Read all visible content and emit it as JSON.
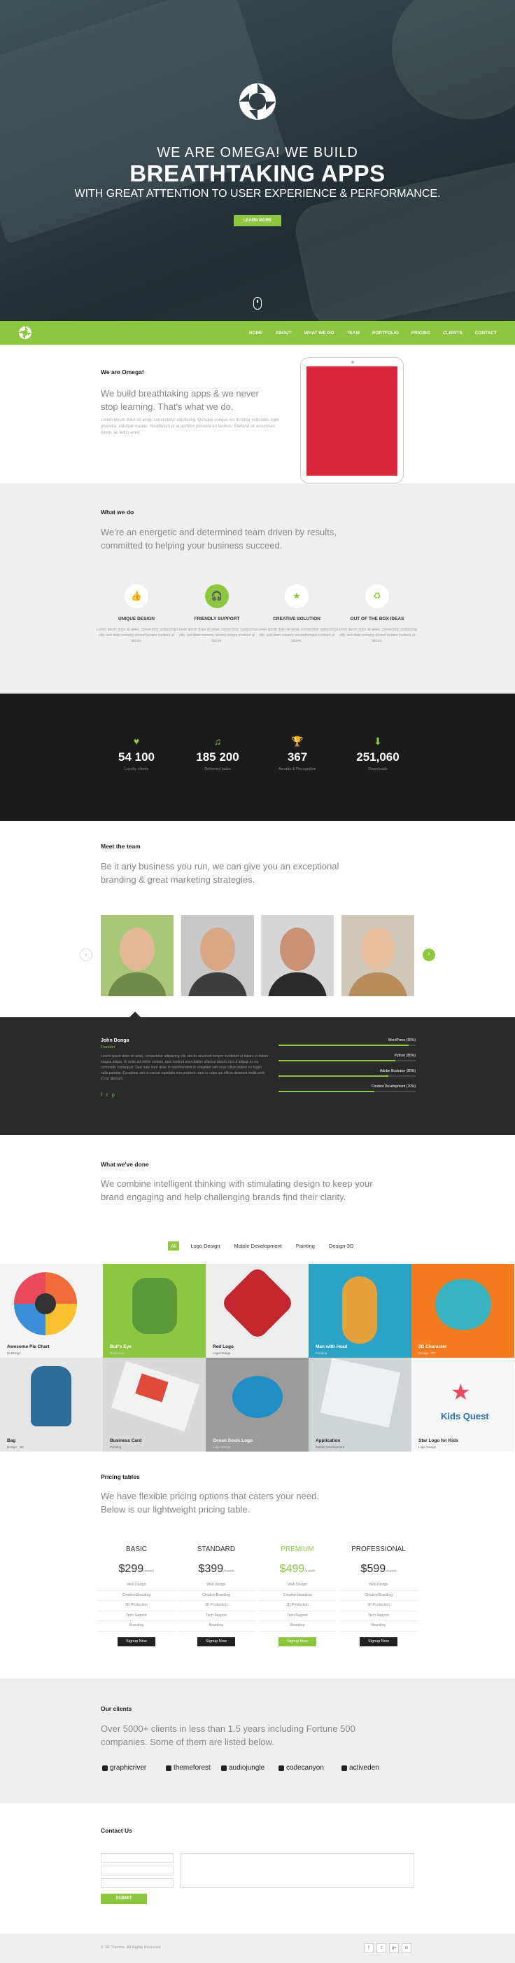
{
  "hero": {
    "subtitle": "WE ARE OMEGA! WE BUILD",
    "title": "BREATHTAKING APPS",
    "tagline": "WITH GREAT ATTENTION TO USER EXPERIENCE & PERFORMANCE.",
    "button": "LEARN MORE",
    "logo_icon": "aperture-icon",
    "scroll_icon": "mouse-icon"
  },
  "nav": {
    "items": [
      "HOME",
      "ABOUT",
      "WHAT WE DO",
      "TEAM",
      "PORTFOLIO",
      "PRICING",
      "CLIENTS",
      "CONTACT"
    ]
  },
  "about": {
    "label": "We are Omega!",
    "lead": "We build breathtaking apps & we never stop learning. That's what we do.",
    "body": "Lorem ipsum dolor sit amet, consectetur adipiscing. Quisque congue leo id tortor vulputate, eget pharetra, volutpat mauris. Vestibulum et at porttitor posuere eu facilisis. Eleifend sit accumsan lorem, ac tellus amet."
  },
  "whatwedo": {
    "label": "What we do",
    "lead": "We're an energetic and determined team driven by results, committed to helping your business succeed.",
    "features": [
      {
        "icon": "thumbs-up-icon",
        "title": "UNIQUE DESIGN",
        "text": "Lorem ipsum dolor sit amet, consectetur sadipscing elitr, sed diam nonumy eirmod tempor invidunt ut labore."
      },
      {
        "icon": "headphones-icon",
        "title": "FRIENDLY SUPPORT",
        "text": "Lorem ipsum dolor sit amet, consectetur sadipscing elitr, sed diam nonumy eirmod tempor invidunt ut labore."
      },
      {
        "icon": "star-icon",
        "title": "CREATIVE SOLUTION",
        "text": "Lorem ipsum dolor sit amet, consectetur sadipscing elitr, sed diam nonumy eirmod tempor invidunt ut labore."
      },
      {
        "icon": "recycle-icon",
        "title": "OUT OF THE BOX IDEAS",
        "text": "Lorem ipsum dolor sit amet, consectetur sadipscing elitr, sed diam nonumy eirmod tempor invidunt ut labore."
      }
    ]
  },
  "stats": [
    {
      "icon": "heart-icon",
      "value": "54 100",
      "label": "Loyalty clients"
    },
    {
      "icon": "saxophone-icon",
      "value": "185 200",
      "label": "Delivered tasks"
    },
    {
      "icon": "trophy-icon",
      "value": "367",
      "label": "Awards & Recognition"
    },
    {
      "icon": "download-icon",
      "value": "251,060",
      "label": "Downloads"
    }
  ],
  "team": {
    "label": "Meet the team",
    "lead": "Be it any business you run, we can give you an exceptional branding & great marketing strategies.",
    "members": [
      {
        "name": "member-1"
      },
      {
        "name": "member-2"
      },
      {
        "name": "member-3"
      },
      {
        "name": "member-4"
      }
    ],
    "active": {
      "name": "John Donga",
      "role": "Founder",
      "bio": "Lorem ipsum dolor sit amet, consectetur adipiscing elit, sed do eiusmod tempor incididunt ut labore et dolore magna aliqua. Ut enim ad minim veniam, quis nostrud exercitation ullamco laboris nisi ut aliquip ex ea commodo consequat. Duis aute irure dolor in reprehenderit in voluptate velit esse cillum dolore eu fugiat nulla pariatur. Excepteur sint occaecat cupidatat non proident, sunt in culpa qui officia deserunt mollit anim id est laborum."
    },
    "skills": [
      {
        "label": "WordPress (95%)",
        "value": 0.95
      },
      {
        "label": "Python (85%)",
        "value": 0.85
      },
      {
        "label": "Adobe Illustrator (80%)",
        "value": 0.8
      },
      {
        "label": "Content Development (70%)",
        "value": 0.7
      }
    ]
  },
  "portfolio": {
    "label": "What we've done",
    "lead": "We combine intelligent thinking with stimulating design to keep your brand engaging and help challenging brands find their clarity.",
    "filters": [
      "All",
      "Logo Design",
      "Mobile Development",
      "Painting",
      "Design-3D"
    ],
    "items": [
      {
        "title": "Awesome Pie Chart",
        "sub": "UI Design"
      },
      {
        "title": "Bull's Eye",
        "sub": "Illustration"
      },
      {
        "title": "Red Logo",
        "sub": "Logo Design"
      },
      {
        "title": "Man with Head",
        "sub": "Painting"
      },
      {
        "title": "3D Character",
        "sub": "Design - 3D"
      },
      {
        "title": "Bag",
        "sub": "Design - 3D"
      },
      {
        "title": "Business Card",
        "sub": "Painting"
      },
      {
        "title": "Ocean Souls Logo",
        "sub": "Logo Design"
      },
      {
        "title": "Application",
        "sub": "Mobile Development"
      },
      {
        "title": "Star Logo for Kids",
        "sub": "Logo Design"
      }
    ]
  },
  "pricing": {
    "label": "Pricing tables",
    "lead": "We have flexible pricing options that caters your need. Below is our lightweight pricing table.",
    "plans": [
      {
        "name": "BASIC",
        "price": "$299",
        "period": "/month"
      },
      {
        "name": "STANDARD",
        "price": "$399",
        "period": "/month"
      },
      {
        "name": "PREMIUM",
        "price": "$499",
        "period": "/month"
      },
      {
        "name": "PROFESSIONAL",
        "price": "$599",
        "period": "/month"
      }
    ],
    "features": [
      "Web Design",
      "Creative Branding",
      "3D Production",
      "Tech Support",
      "Branding"
    ],
    "button": "Signup Now"
  },
  "clients": {
    "label": "Our clients",
    "lead": "Over 5000+ clients in less than 1.5 years including Fortune 500 companies. Some of them are listed below.",
    "logos": [
      "graphicriver",
      "themeforest",
      "audiojungle",
      "codecanyon",
      "activeden"
    ]
  },
  "contact": {
    "label": "Contact Us",
    "submit": "SUBMIT"
  },
  "footer": {
    "copyright": "© SK Themes. All Rights Reserved.",
    "social": [
      "f",
      "t",
      "g+",
      "in"
    ]
  },
  "colors": {
    "accent": "#8dc63f",
    "dark": "#1b1b1b",
    "light": "#efefef"
  }
}
